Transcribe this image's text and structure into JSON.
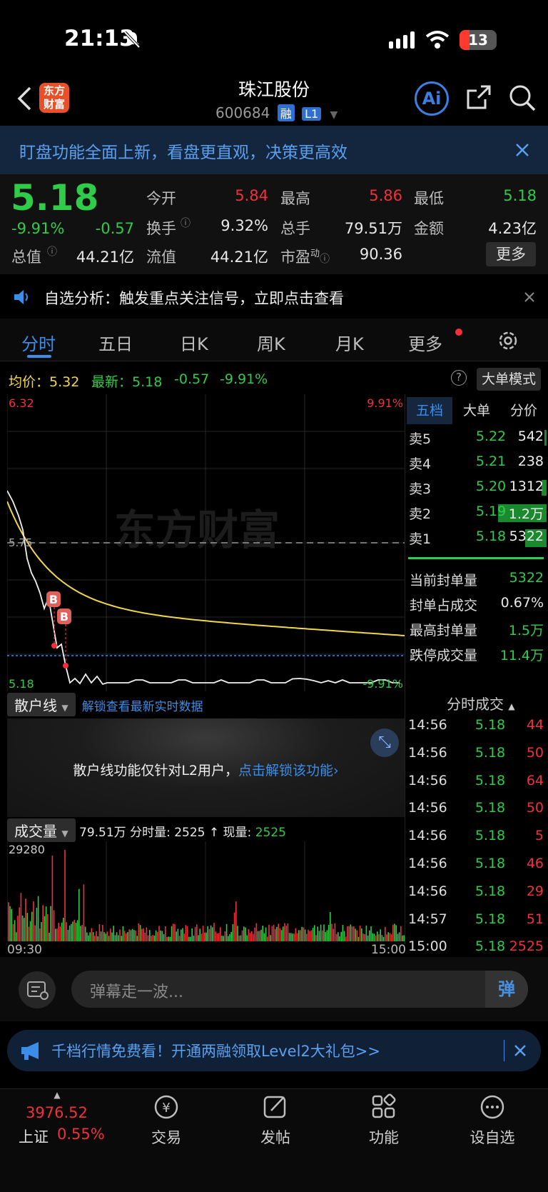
{
  "status_bar": {
    "time": "21:13",
    "battery": "13"
  },
  "header": {
    "logo_text": "东方财富",
    "title": "珠江股份",
    "code": "600684",
    "tag_margin": "融",
    "tag_level": "L1",
    "ai_label": "Ai"
  },
  "banner_top": {
    "text": "盯盘功能全面上新，看盘更直观，决策更高效"
  },
  "quote": {
    "price": "5.18",
    "change_pct": "-9.91%",
    "change": "-0.57",
    "open_label": "今开",
    "open": "5.84",
    "high_label": "最高",
    "high": "5.86",
    "low_label": "最低",
    "low": "5.18",
    "turnover_label": "换手",
    "turnover": "9.32%",
    "volume_label": "总手",
    "volume": "79.51万",
    "amount_label": "金额",
    "amount": "4.23亿",
    "mktcap_label": "总值",
    "mktcap": "44.21亿",
    "float_label": "流值",
    "float": "44.21亿",
    "pe_label": "市盈",
    "pe_sup": "动",
    "pe": "90.36",
    "more_label": "更多"
  },
  "alert": {
    "text": "自选分析：触发重点关注信号，立即点击查看"
  },
  "tabs": [
    "分时",
    "五日",
    "日K",
    "周K",
    "月K",
    "更多"
  ],
  "infobar": {
    "avg_label": "均价：",
    "avg": "5.32",
    "latest_label": "最新：",
    "latest": "5.18",
    "change": "-0.57",
    "change_pct": "-9.91%",
    "big_order_label": "大单模式"
  },
  "chart_labels": {
    "top_price": "6.32",
    "top_pct": "9.91%",
    "mid_price": "5.75",
    "bottom_price": "5.18",
    "bottom_pct": "-9.91%",
    "watermark": "东方财富",
    "marker": "B"
  },
  "orderbook": {
    "tabs": [
      "五档",
      "大单",
      "分价"
    ],
    "rows": [
      {
        "k": "卖5",
        "p": "5.22",
        "q": "542"
      },
      {
        "k": "卖4",
        "p": "5.21",
        "q": "238"
      },
      {
        "k": "卖3",
        "p": "5.20",
        "q": "1312"
      },
      {
        "k": "卖2",
        "p": "5.19",
        "q": "1.2万"
      },
      {
        "k": "卖1",
        "p": "5.18",
        "q": "5322"
      }
    ],
    "seal": [
      {
        "k": "当前封单量",
        "v": "5322"
      },
      {
        "k": "封单占成交",
        "v": "0.67%"
      },
      {
        "k": "最高封单量",
        "v": "1.5万"
      },
      {
        "k": "跌停成交量",
        "v": "11.4万"
      }
    ]
  },
  "sanhu": {
    "select_label": "散户线",
    "unlock_link": "解锁查看最新实时数据",
    "panel_msg": "散户线功能仅针对L2用户，",
    "panel_link": "点击解锁该功能"
  },
  "ticks": {
    "title": "分时成交",
    "rows": [
      {
        "t": "14:56",
        "p": "5.18",
        "v": "44"
      },
      {
        "t": "14:56",
        "p": "5.18",
        "v": "50"
      },
      {
        "t": "14:56",
        "p": "5.18",
        "v": "64"
      },
      {
        "t": "14:56",
        "p": "5.18",
        "v": "50"
      },
      {
        "t": "14:56",
        "p": "5.18",
        "v": "5"
      },
      {
        "t": "14:56",
        "p": "5.18",
        "v": "46"
      },
      {
        "t": "14:56",
        "p": "5.18",
        "v": "29"
      },
      {
        "t": "14:57",
        "p": "5.18",
        "v": "51"
      },
      {
        "t": "15:00",
        "p": "5.18",
        "v": "2525"
      }
    ]
  },
  "volume": {
    "select_label": "成交量",
    "total": "79.51万",
    "minute_label": "分时量:",
    "minute": "2525",
    "now_label": "现量:",
    "now": "2525",
    "max": "29280",
    "start_time": "09:30",
    "end_time": "15:00"
  },
  "danmu": {
    "placeholder": "弹幕走一波...",
    "send_label": "弹"
  },
  "banner_bottom": {
    "text": "千档行情免费看！开通两融领取Level2大礼包>>"
  },
  "nav": {
    "index_value": "3976.52",
    "index_name": "上证",
    "index_pct": "0.55%",
    "items": [
      "交易",
      "发帖",
      "功能",
      "设自选"
    ]
  },
  "colors": {
    "up": "#f0313b",
    "down": "#2ecc48",
    "accent": "#3b8de8",
    "avg_line": "#f2d64a"
  }
}
